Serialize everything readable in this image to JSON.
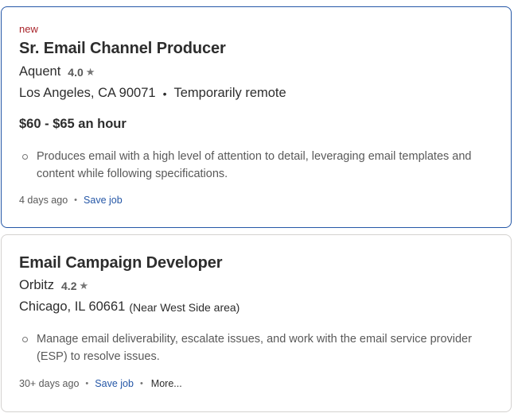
{
  "jobs": [
    {
      "tag": "new",
      "title": "Sr. Email Channel Producer",
      "company": "Aquent",
      "rating": "4.0",
      "location": "Los Angeles, CA 90071",
      "remote": "Temporarily remote",
      "salary": "$60 - $65 an hour",
      "snippet": "Produces email with a high level of attention to detail, leveraging email templates and content while following specifications.",
      "posted": "4 days ago",
      "save_label": "Save job"
    },
    {
      "title": "Email Campaign Developer",
      "company": "Orbitz",
      "rating": "4.2",
      "location": "Chicago, IL 60661",
      "area": "(Near West Side area)",
      "snippet": "Manage email deliverability, escalate issues, and work with the email service provider (ESP) to resolve issues.",
      "posted": "30+ days ago",
      "save_label": "Save job",
      "more_label": "More..."
    }
  ],
  "icons": {
    "star": "star-icon",
    "bullet": "bullet-icon"
  },
  "colors": {
    "link": "#2557a7",
    "new_tag": "#a9252b",
    "selected_border": "#2557a7"
  }
}
